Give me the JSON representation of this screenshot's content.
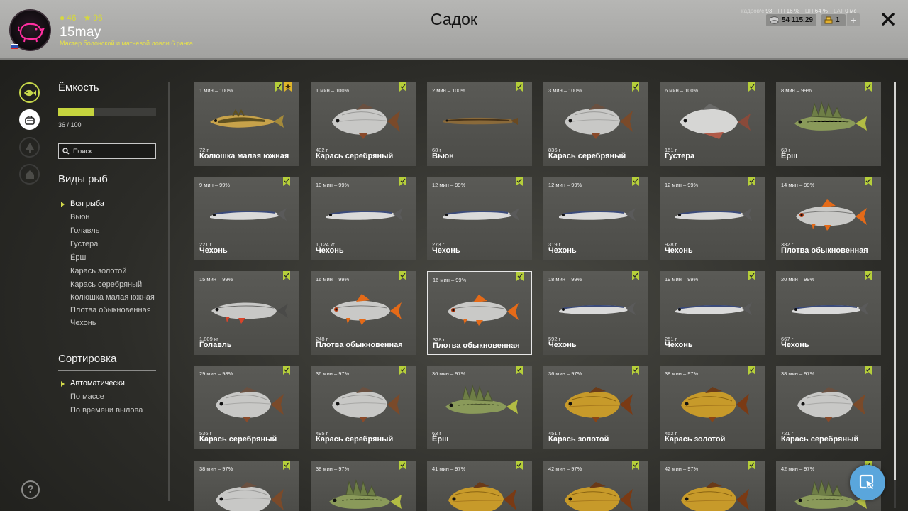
{
  "header": {
    "title": "Садок",
    "player": {
      "name": "15may",
      "rank": "Мастер болонской и матчевой ловли 6 ранга",
      "coins": "46",
      "stars": "96"
    },
    "perf": {
      "fps_label": "кадров/с",
      "fps": "93",
      "gpu_label": "ГП",
      "gpu": "16 %",
      "cpu_label": "ЦП",
      "cpu": "64 %",
      "lat_label": "LAT",
      "lat": "0 мс"
    },
    "silver": "54 115,29",
    "gold": "1",
    "plus": "+"
  },
  "capacity": {
    "title": "Ёмкость",
    "value": "36 / 100",
    "fraction": 0.36
  },
  "search": {
    "placeholder": "Поиск..."
  },
  "species": {
    "title": "Виды рыб",
    "items": [
      "Вся рыба",
      "Вьюн",
      "Голавль",
      "Густера",
      "Ёрш",
      "Карась золотой",
      "Карась серебряный",
      "Колюшка малая южная",
      "Плотва обыкновенная",
      "Чехонь"
    ],
    "selected": 0
  },
  "sort": {
    "title": "Сортировка",
    "items": [
      "Автоматически",
      "По массе",
      "По времени вылова"
    ],
    "selected": 0
  },
  "help": "?",
  "colors": {
    "accent": "#c6d43e",
    "bookmark_green": "#b6cf3a",
    "bookmark_gold": "#e0b62a",
    "fab": "#5aa6dc"
  },
  "fish": [
    {
      "time": "1 мин – 100%",
      "weight": "72 г",
      "name": "Колюшка малая южная",
      "kind": "stickleback",
      "gold_mark": true
    },
    {
      "time": "1 мин – 100%",
      "weight": "402 г",
      "name": "Карась серебряный",
      "kind": "carp-silver"
    },
    {
      "time": "2 мин – 100%",
      "weight": "68 г",
      "name": "Вьюн",
      "kind": "loach"
    },
    {
      "time": "3 мин – 100%",
      "weight": "836 г",
      "name": "Карась серебряный",
      "kind": "carp-silver"
    },
    {
      "time": "6 мин – 100%",
      "weight": "151 г",
      "name": "Густера",
      "kind": "bream"
    },
    {
      "time": "8 мин – 99%",
      "weight": "63 г",
      "name": "Ёрш",
      "kind": "ruffe"
    },
    {
      "time": "9 мин – 99%",
      "weight": "221 г",
      "name": "Чехонь",
      "kind": "sabre"
    },
    {
      "time": "10 мин – 99%",
      "weight": "1,124 кг",
      "name": "Чехонь",
      "kind": "sabre"
    },
    {
      "time": "12 мин – 99%",
      "weight": "273 г",
      "name": "Чехонь",
      "kind": "sabre"
    },
    {
      "time": "12 мин – 99%",
      "weight": "319 г",
      "name": "Чехонь",
      "kind": "sabre"
    },
    {
      "time": "12 мин – 99%",
      "weight": "928 г",
      "name": "Чехонь",
      "kind": "sabre"
    },
    {
      "time": "14 мин – 99%",
      "weight": "382 г",
      "name": "Плотва обыкновенная",
      "kind": "roach"
    },
    {
      "time": "15 мин – 99%",
      "weight": "1,809 кг",
      "name": "Голавль",
      "kind": "chub"
    },
    {
      "time": "16 мин – 99%",
      "weight": "248 г",
      "name": "Плотва обыкновенная",
      "kind": "roach"
    },
    {
      "time": "16 мин – 99%",
      "weight": "328 г",
      "name": "Плотва обыкновенная",
      "kind": "roach",
      "selected": true
    },
    {
      "time": "18 мин – 99%",
      "weight": "592 г",
      "name": "Чехонь",
      "kind": "sabre"
    },
    {
      "time": "19 мин – 99%",
      "weight": "251 г",
      "name": "Чехонь",
      "kind": "sabre"
    },
    {
      "time": "20 мин – 99%",
      "weight": "667 г",
      "name": "Чехонь",
      "kind": "sabre"
    },
    {
      "time": "29 мин – 98%",
      "weight": "536 г",
      "name": "Карась серебряный",
      "kind": "carp-silver"
    },
    {
      "time": "36 мин – 97%",
      "weight": "495 г",
      "name": "Карась серебряный",
      "kind": "carp-silver"
    },
    {
      "time": "36 мин – 97%",
      "weight": "63 г",
      "name": "Ёрш",
      "kind": "ruffe"
    },
    {
      "time": "36 мин – 97%",
      "weight": "451 г",
      "name": "Карась золотой",
      "kind": "carp-gold"
    },
    {
      "time": "38 мин – 97%",
      "weight": "452 г",
      "name": "Карась золотой",
      "kind": "carp-gold"
    },
    {
      "time": "38 мин – 97%",
      "weight": "721 г",
      "name": "Карась серебряный",
      "kind": "carp-silver"
    },
    {
      "time": "38 мин – 97%",
      "weight": "",
      "name": "",
      "kind": "carp-silver"
    },
    {
      "time": "38 мин – 97%",
      "weight": "",
      "name": "",
      "kind": "ruffe"
    },
    {
      "time": "41 мин – 97%",
      "weight": "",
      "name": "",
      "kind": "carp-gold"
    },
    {
      "time": "42 мин – 97%",
      "weight": "",
      "name": "",
      "kind": "carp-gold"
    },
    {
      "time": "42 мин – 97%",
      "weight": "",
      "name": "",
      "kind": "carp-gold"
    },
    {
      "time": "42 мин – 97%",
      "weight": "",
      "name": "",
      "kind": "ruffe"
    }
  ]
}
